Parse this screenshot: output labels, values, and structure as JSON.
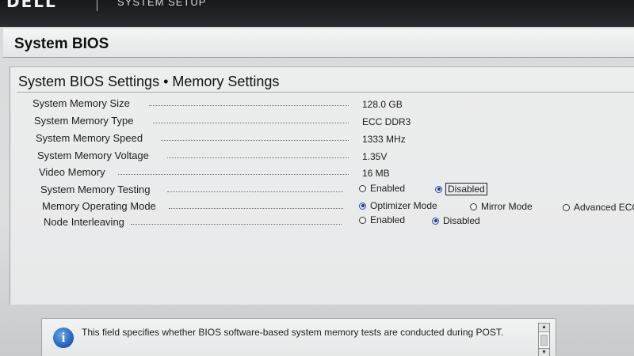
{
  "topbar": {
    "brand": "DELL",
    "setup_title": "SYSTEM SETUP"
  },
  "header": {
    "title": "System BIOS"
  },
  "content": {
    "title": "System BIOS Settings • Memory Settings",
    "rows": [
      {
        "label": "System Memory Size",
        "value": "128.0 GB"
      },
      {
        "label": "System Memory Type",
        "value": "ECC DDR3"
      },
      {
        "label": "System Memory Speed",
        "value": "1333 MHz"
      },
      {
        "label": "System Memory Voltage",
        "value": "1.35V"
      },
      {
        "label": "Video Memory",
        "value": "16 MB"
      },
      {
        "label": "System Memory Testing",
        "options": [
          "Enabled",
          "Disabled"
        ],
        "selected": "Disabled"
      },
      {
        "label": "Memory Operating Mode",
        "options": [
          "Optimizer Mode",
          "Mirror Mode",
          "Advanced ECC"
        ],
        "selected": "Optimizer Mode"
      },
      {
        "label": "Node Interleaving",
        "options": [
          "Enabled",
          "Disabled"
        ],
        "selected": "Disabled"
      }
    ]
  },
  "help": {
    "icon": "info-icon",
    "text": "This field specifies whether BIOS software-based system memory tests are conducted during POST.",
    "scroll_up": "▲",
    "scroll_down": "▼"
  },
  "colors": {
    "selected_radio": "#1d3f8a",
    "panel_bg": "#dcdedf",
    "topbar_bg": "#1e2024"
  }
}
